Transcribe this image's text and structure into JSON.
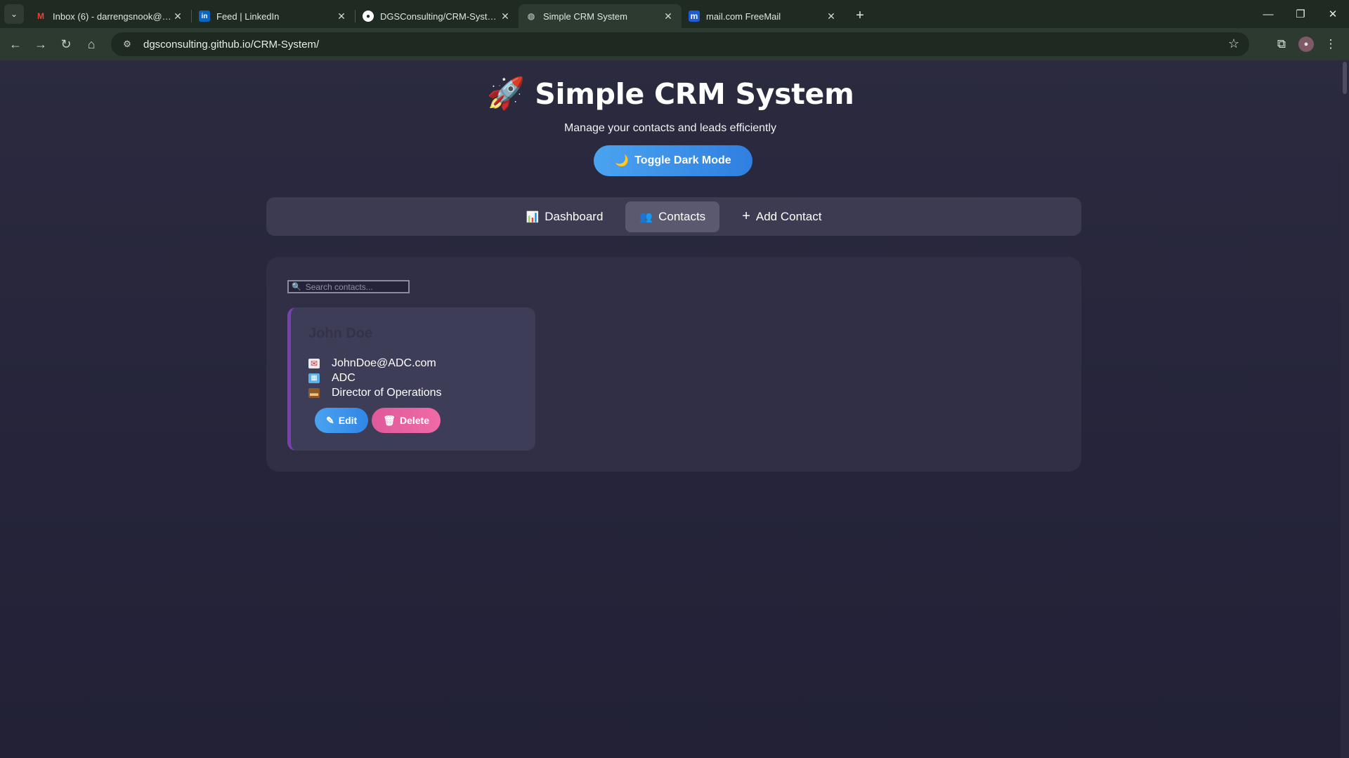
{
  "browser": {
    "tabs": [
      {
        "title": "Inbox (6) - darrengsnook@gmail.com",
        "favicon": "M",
        "favicon_color": "#ea4335",
        "active": false
      },
      {
        "title": "Feed | LinkedIn",
        "favicon": "in",
        "favicon_color": "#0a66c2",
        "active": false
      },
      {
        "title": "DGSConsulting/CRM-System: A",
        "favicon": "gh",
        "favicon_color": "#ffffff",
        "active": false
      },
      {
        "title": "Simple CRM System",
        "favicon": "globe",
        "favicon_color": "#9aa39c",
        "active": true
      },
      {
        "title": "mail.com FreeMail",
        "favicon": "m",
        "favicon_color": "#1e5bd8",
        "active": false
      }
    ],
    "url": "dgsconsulting.github.io/CRM-System/"
  },
  "header": {
    "icon": "🚀",
    "title": "Simple CRM System",
    "subtitle": "Manage your contacts and leads efficiently",
    "toggle_icon": "🌙",
    "toggle_label": "Toggle Dark Mode"
  },
  "nav": {
    "dashboard_icon": "📊",
    "dashboard_label": "Dashboard",
    "contacts_icon": "👥",
    "contacts_label": "Contacts",
    "add_icon": "+",
    "add_label": "Add Contact"
  },
  "search": {
    "placeholder": "Search contacts...",
    "icon": "🔍"
  },
  "contacts": [
    {
      "name": "John Doe",
      "email": "JohnDoe@ADC.com",
      "company": "ADC",
      "position": "Director of Operations",
      "edit_label": "Edit",
      "delete_label": "Delete"
    }
  ],
  "colors": {
    "accent_blue": "#3a8fe8",
    "delete_pink": "#e85fa0",
    "card_border": "#7a3fb0"
  }
}
